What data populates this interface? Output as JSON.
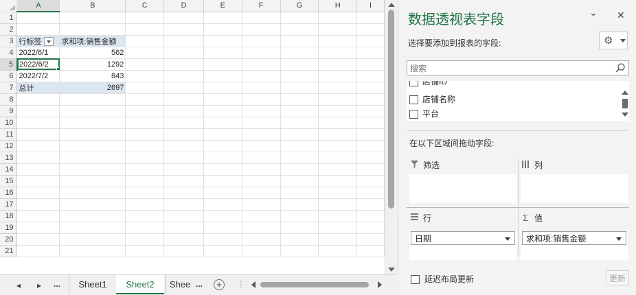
{
  "sheet": {
    "column_headers": [
      "A",
      "B",
      "C",
      "D",
      "E",
      "F",
      "G",
      "H",
      "I"
    ],
    "row_numbers": [
      "1",
      "2",
      "3",
      "4",
      "5",
      "6",
      "7",
      "8",
      "9",
      "10",
      "11",
      "12",
      "13",
      "14",
      "15",
      "16",
      "17",
      "18",
      "19",
      "20",
      "21"
    ],
    "pivot": {
      "row_label_header": "行标签",
      "value_header": "求和项:销售金额",
      "rows": [
        {
          "label": "2022/6/1",
          "value": "562"
        },
        {
          "label": "2022/6/2",
          "value": "1292"
        },
        {
          "label": "2022/7/2",
          "value": "843"
        }
      ],
      "total_label": "总计",
      "total_value": "2697"
    }
  },
  "tabs": {
    "nav_prev": "◂",
    "nav_next": "▸",
    "nav_more": "...",
    "items": [
      "Sheet1",
      "Sheet2",
      "Shee"
    ],
    "active": "Sheet2",
    "more": "...",
    "add": "+"
  },
  "pane": {
    "title": "数据透视表字段",
    "dropdown_glyph": "⌄",
    "close_glyph": "✕",
    "subtitle": "选择要添加到报表的字段:",
    "gear_glyph": "⚙",
    "search_placeholder": "搜索",
    "fields": [
      "店铺ID",
      "店铺名称",
      "平台"
    ],
    "drag_label": "在以下区域间拖动字段:",
    "areas": {
      "filter": {
        "label": "筛选",
        "icon": "filter-icon"
      },
      "columns": {
        "label": "列",
        "icon": "columns-icon"
      },
      "rows": {
        "label": "行",
        "icon": "rows-icon",
        "field": "日期"
      },
      "values": {
        "label": "值",
        "icon": "sigma-icon",
        "field": "求和项:销售金额"
      }
    },
    "defer_label": "延迟布局更新",
    "update_label": "更新"
  },
  "colors": {
    "accent": "#217346",
    "pivot_header_bg": "#dce6f1"
  }
}
